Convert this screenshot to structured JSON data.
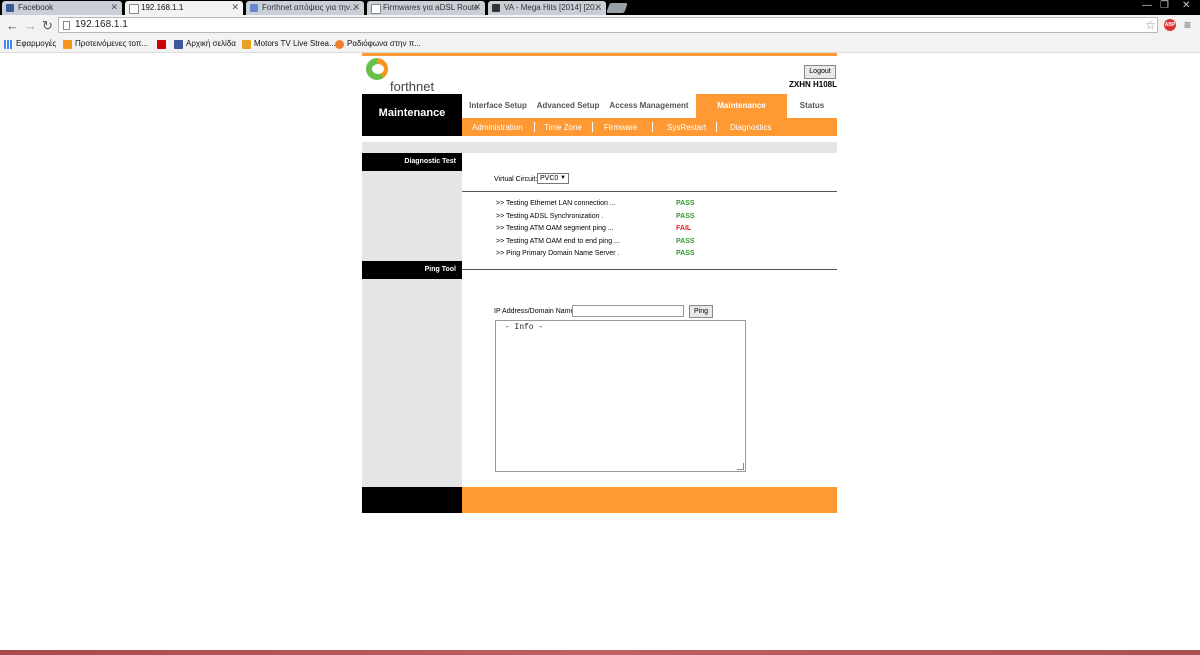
{
  "browser": {
    "tabs": [
      {
        "label": "Facebook"
      },
      {
        "label": "192.168.1.1"
      },
      {
        "label": "Forthnet απόψεις για την..."
      },
      {
        "label": "Firmwares για aDSL Route"
      },
      {
        "label": "VA - Mega Hits [2014] [20..."
      }
    ],
    "url": "192.168.1.1",
    "bookmarks": [
      {
        "label": "Εφαρμογές"
      },
      {
        "label": "Προτεινόμενες τοπ..."
      },
      {
        "label": ""
      },
      {
        "label": "Αρχική σελίδα"
      },
      {
        "label": "Motors TV Live Strea..."
      },
      {
        "label": "Ραδιόφωνα στην π..."
      }
    ]
  },
  "router": {
    "brand": "forthnet",
    "logout_label": "Logout",
    "model": "ZXHN H108L",
    "section_title": "Maintenance",
    "nav_tabs": [
      {
        "label": "Interface Setup"
      },
      {
        "label": "Advanced Setup"
      },
      {
        "label": "Access Management"
      },
      {
        "label": "Maintenance"
      },
      {
        "label": "Status"
      }
    ],
    "sub_nav": [
      {
        "label": "Administration"
      },
      {
        "label": "Time Zone"
      },
      {
        "label": "Firmware"
      },
      {
        "label": "SysRestart"
      },
      {
        "label": "Diagnostics"
      }
    ],
    "diagnostic_header": "Diagnostic Test",
    "virtual_circuit_label": "Virtual Circuit:",
    "virtual_circuit_value": "PVC0",
    "tests": [
      {
        "label": ">> Testing Ethernet LAN connection ...",
        "result": "PASS"
      },
      {
        "label": ">> Testing ADSL Synchronization .",
        "result": "PASS"
      },
      {
        "label": ">> Testing ATM OAM segment ping ...",
        "result": "FAIL"
      },
      {
        "label": ">> Testing ATM OAM end to end ping ...",
        "result": "PASS"
      },
      {
        "label": ">> Ping Primary Domain Name Server .",
        "result": "PASS"
      }
    ],
    "ping_header": "Ping Tool",
    "ip_label": "IP Address/Domain Name:",
    "ip_value": "",
    "ping_button": "Ping",
    "info_text": " - Info -"
  },
  "colors": {
    "accent": "#ff9933",
    "pass": "#339933",
    "fail": "#e02020"
  }
}
